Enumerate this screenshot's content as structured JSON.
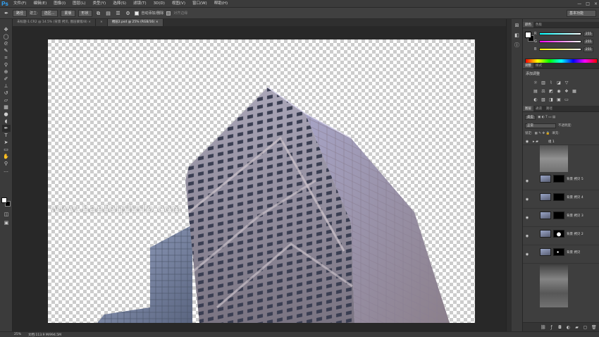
{
  "app": {
    "logo": "Ps"
  },
  "menu": [
    "文件(F)",
    "编辑(E)",
    "图像(I)",
    "图层(L)",
    "类型(Y)",
    "选择(S)",
    "滤镜(T)",
    "3D(D)",
    "视图(V)",
    "窗口(W)",
    "帮助(H)"
  ],
  "window_controls": [
    "—",
    "□",
    "×"
  ],
  "options": {
    "mode": "路径",
    "make_label": "建立:",
    "selection_btn": "选区...",
    "mask_btn": "蒙版",
    "shape_btn": "形状",
    "auto_add_delete": "自动添加/删除",
    "align_edges": "对齐边缘",
    "workspace": "基本功能"
  },
  "tabs": [
    {
      "label": "未标题-1.CR2 @ 14.5% (背景 拷贝, 图层蒙版/8) ×",
      "active": false
    },
    {
      "label": "×",
      "active": false
    },
    {
      "label": "楼层2.psd @ 25% (RGB/16) ×",
      "active": true
    }
  ],
  "watermark": "www.hanfeiphoto.com",
  "color_panel": {
    "tabs": [
      "颜色",
      "色板"
    ],
    "channels": [
      {
        "label": "R",
        "value": "255",
        "gradient": "linear-gradient(to right, #00ffff, #ffffff)"
      },
      {
        "label": "G",
        "value": "255",
        "gradient": "linear-gradient(to right, #ff00ff, #ffffff)"
      },
      {
        "label": "B",
        "value": "255",
        "gradient": "linear-gradient(to right, #ffff00, #ffffff)"
      }
    ]
  },
  "adjustments": {
    "tabs": [
      "调整",
      "样式"
    ],
    "title": "添加调整"
  },
  "layers": {
    "tabs": [
      "图层",
      "通道",
      "路径"
    ],
    "filter_kind": "类型",
    "blend_mode": "正常",
    "opacity_label": "不透明度:",
    "lock_label": "锁定:",
    "fill_label": "填充:",
    "group_name": "组 1",
    "items": [
      {
        "name": "背景 拷贝 5",
        "mask_variant": "line"
      },
      {
        "name": "背景 拷贝 4",
        "mask_variant": "dark"
      },
      {
        "name": "背景 拷贝 3",
        "mask_variant": "dark"
      },
      {
        "name": "背景 拷贝 2",
        "mask_variant": "white"
      },
      {
        "name": "背景 拷贝",
        "mask_variant": "dot"
      }
    ]
  },
  "status": {
    "zoom": "25%",
    "doc": "文档:113.9 M/994.5M"
  }
}
